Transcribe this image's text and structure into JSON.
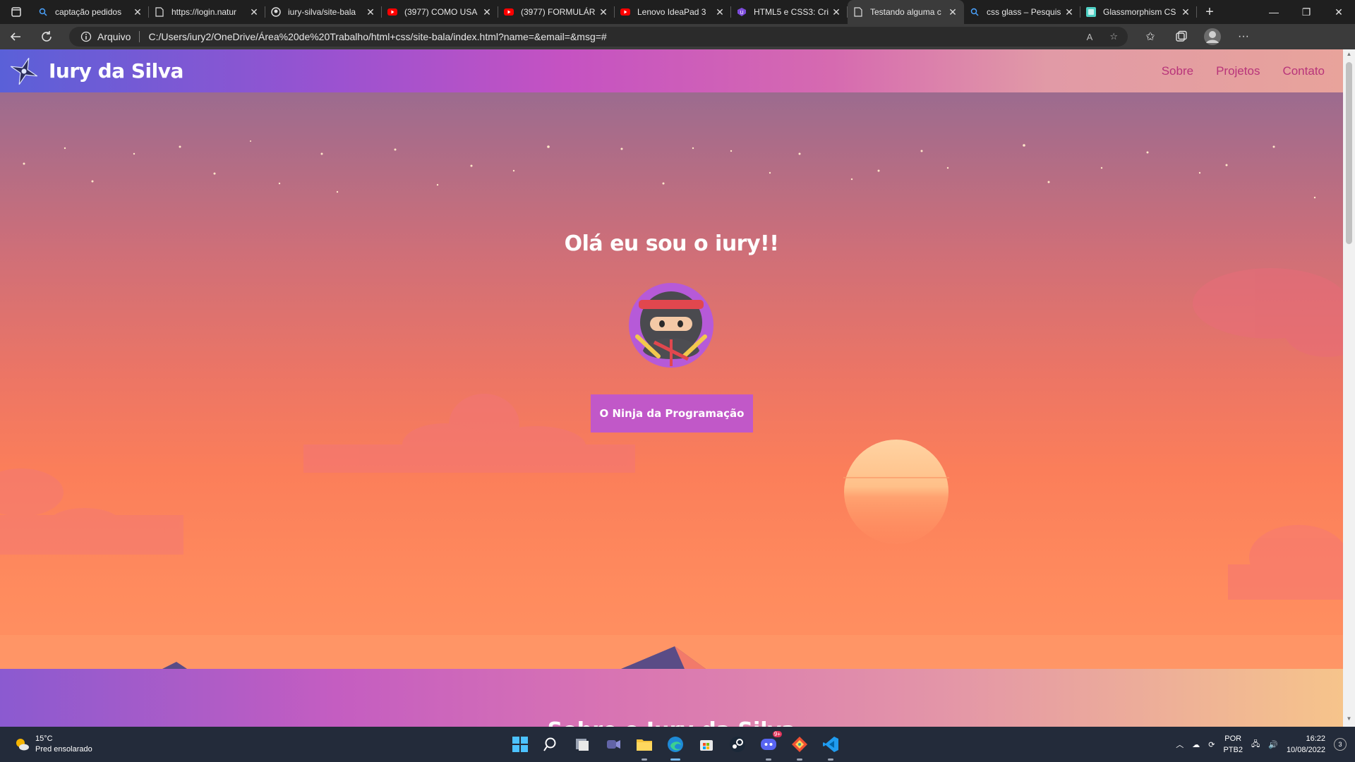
{
  "browser": {
    "tabs": [
      {
        "title": "captação pedidos",
        "icon": "search-icon"
      },
      {
        "title": "https://login.natur",
        "icon": "page-icon"
      },
      {
        "title": "iury-silva/site-bala",
        "icon": "github-icon"
      },
      {
        "title": "(3977) COMO USA",
        "icon": "youtube-icon"
      },
      {
        "title": "(3977) FORMULÁR",
        "icon": "youtube-icon"
      },
      {
        "title": "Lenovo IdeaPad 3",
        "icon": "youtube-icon"
      },
      {
        "title": "HTML5 e CSS3: Cri",
        "icon": "course-icon"
      },
      {
        "title": "Testando alguma c",
        "icon": "page-icon",
        "active": true
      },
      {
        "title": "css glass – Pesquis",
        "icon": "search-icon"
      },
      {
        "title": "Glassmorphism CS",
        "icon": "glass-icon"
      }
    ],
    "address": {
      "scheme_label": "Arquivo",
      "url": "C:/Users/iury2/OneDrive/Área%20de%20Trabalho/html+css/site-bala/index.html?name=&email=&msg=#"
    }
  },
  "site": {
    "brand": "Iury da Silva",
    "nav": [
      "Sobre",
      "Projetos",
      "Contato"
    ],
    "hero_title": "Olá eu sou o iury!!",
    "cta_label": "O Ninja da Programação",
    "next_section_title": "Sobre o Iury da Silva"
  },
  "taskbar": {
    "weather_temp": "15°C",
    "weather_desc": "Pred ensolarado",
    "lang_1": "POR",
    "lang_2": "PTB2",
    "time": "16:22",
    "date": "10/08/2022",
    "discord_badge": "9+",
    "notifications": "3"
  },
  "colors": {
    "nav_link": "#b8347a",
    "cta_bg": "#c158c8"
  }
}
